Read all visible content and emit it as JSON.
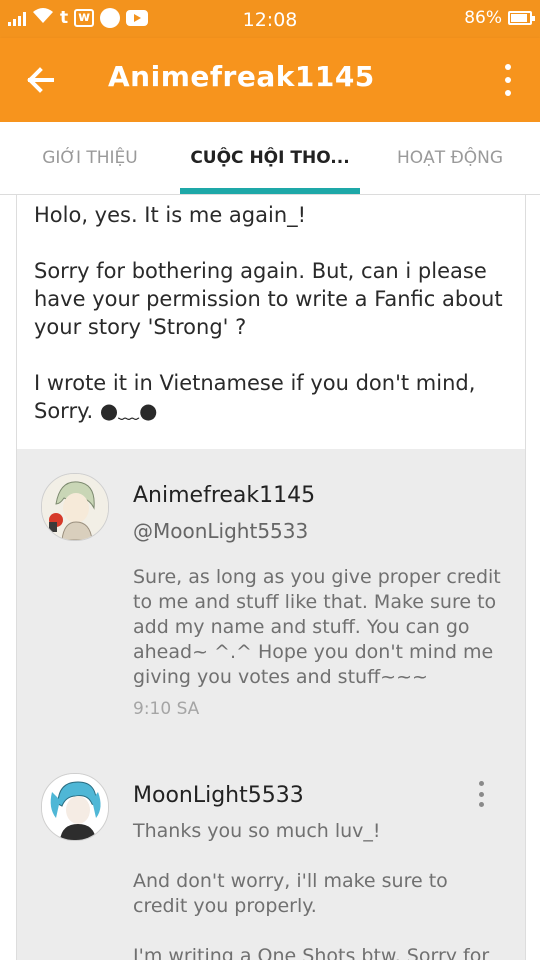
{
  "status_bar": {
    "time": "12:08",
    "battery": "86%",
    "notif_icons": [
      "signal-icon",
      "wifi-icon",
      "tumblr-icon",
      "wattpad-icon",
      "messenger-icon",
      "youtube-icon"
    ]
  },
  "app_bar": {
    "title": "Animefreak1145"
  },
  "tabs": [
    {
      "label": "GIỚI THIỆU",
      "active": false
    },
    {
      "label": "CUỘC HỘI THO...",
      "active": true
    },
    {
      "label": "HOẠT ĐỘNG",
      "active": false
    }
  ],
  "message": {
    "paragraphs": [
      "Holo, yes. It is me again_!",
      "Sorry for bothering again. But, can i please have your permission to write a Fanfic about your story 'Strong' ?",
      "I wrote it in Vietnamese if you don't mind, Sorry. ●﹏●"
    ]
  },
  "replies": [
    {
      "name": "Animefreak1145",
      "handle": "@MoonLight5533",
      "text": "Sure, as long as you give proper credit to me and stuff like that. Make sure to add my name and stuff. You can go ahead~ ^.^ Hope you don't mind me giving you votes and stuff~~~",
      "time": "9:10 SA"
    },
    {
      "name": "MoonLight5533",
      "paragraphs": [
        "Thanks you so much luv_!",
        "And don't worry, i'll make sure to credit you properly.",
        "I'm writing a One Shots btw. Sorry for"
      ]
    }
  ],
  "colors": {
    "accent": "#f7941d",
    "tab_indicator": "#1ea8a8"
  }
}
